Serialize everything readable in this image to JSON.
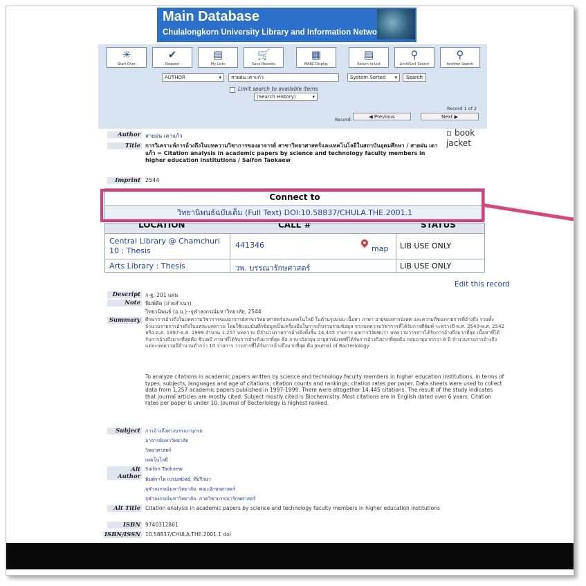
{
  "banner": {
    "title": "Main Database",
    "subtitle": "Chulalongkorn University Library and Information Network"
  },
  "toolbar": {
    "buttons": [
      {
        "label": "Start Over",
        "icon": "✳"
      },
      {
        "label": "Request",
        "icon": "✔"
      },
      {
        "label": "My Lists",
        "icon": "▤"
      },
      {
        "label": "Save Records",
        "icon": "🛒"
      },
      {
        "label": "MARC Display",
        "icon": "▦"
      },
      {
        "label": "Return to List",
        "icon": "▤"
      },
      {
        "label": "Limit/Sort Search",
        "icon": "⚲"
      },
      {
        "label": "Another Search",
        "icon": "⚲"
      }
    ]
  },
  "search": {
    "field_type": "AUTHOR",
    "query": "สายฝน เตาแก้ว",
    "sort": "System Sorted",
    "search_button": "Search",
    "limit_label": "Limit search to available items",
    "history": "(Search History)"
  },
  "record_nav": {
    "record_label": "Record:",
    "record_count": "Record 1 of 2",
    "prev": "Previous",
    "next": "Next"
  },
  "record": {
    "author_label": "Author",
    "author": "สายฝน เตาแก้ว",
    "title_label": "Title",
    "title": "การวิเคราะห์การอ้างถึงในบทความวิชาการของอาจารย์ สาขาวิทยาศาสตร์และเทคโนโลยีในสถาบันอุดมศึกษา / สายฝน เตาแก้ว = Citation analysis in academic papers by science and technology faculty members in higher education institutions / Saifon Taokaew",
    "imprint_label": "Imprint",
    "imprint": "2544",
    "jacket": "book jacket"
  },
  "connect": {
    "heading": "Connect to",
    "link": "วิทยานิพนธ์ฉบับเต็ม (Full Text) DOI:10.58837/CHULA.THE.2001.1"
  },
  "holdings": {
    "headers": [
      "LOCATION",
      "CALL #",
      "STATUS"
    ],
    "rows": [
      {
        "location": "Central Library @ Chamchuri 10 : Thesis",
        "call": "441346",
        "map": "map",
        "status": "LIB USE ONLY"
      },
      {
        "location": "Arts Library : Thesis",
        "call": "วพ. บรรณารักษศาสตร์",
        "map": "",
        "status": "LIB USE ONLY"
      }
    ]
  },
  "edit_link": "Edit this record",
  "details": {
    "descript_label": "Descript",
    "descript": "ก-ฐ, 201 แผ่น",
    "note_label": "Note",
    "note1": "พิมพ์ดีด (ถ่ายสำเนา)",
    "note2": "วิทยานิพนธ์ (อ.ม.)--จุฬาลงกรณ์มหาวิทยาลัย, 2544",
    "summary_label": "Summary",
    "summary_thai": "ศึกษาการอ้างถึงในบทความวิชาการของอาจารย์สาขาวิทยาศาสตร์และเทคโนโลยี ในด้านรูปแบบ เนื้อหา ภาษา อายุของสารนิเทศ และความถี่ของรายการที่อ้างถึง รวมทั้งจำนวนรายการอ้างถึงในแต่ละบทความ โดยใช้แบบบันทึกข้อมูลเป็นเครื่องมือในการเก็บรวบรวมข้อมูล จากบทความวิชาการที่ได้รับการตีพิมพ์ ระหว่างปี พ.ศ. 2540-พ.ศ. 2542 หรือ ค.ศ. 1997-ค.ศ. 1999 จำนวน 1,257 บทความ มีจำนวนรายการอ้างอิงทั้งสิ้น 14,445 รายการ ผลการวิจัยพบว่า บทความวารสารได้รับการอ้างถึงมากที่สุด เนื้อหาที่ได้รับการอ้างถึงมากที่สุดคือ ชีวเคมี ภาษาที่ได้รับการอ้างถึงมากที่สุด คือ ภาษาอังกฤษ อายุสารนิเทศที่ได้รับการอ้างถึงมากที่สุดคือ กลุ่มอายุมากกว่า 6 ปี จำนวนรายการอ้างถึงแต่ละบทความมีจำนวนต่ำกว่า 10 รายการ วารสารที่ได้รับการอ้างถึงมากที่สุด คือ Journal of Bacteriology",
    "summary_en": "To analyze citations in academic papers written by science and technology faculty members in higher education institutions, in terms of types, subjects, languages and age of citations; citation counts and rankings; citation rates per paper. Data sheets were used to collect data from 1,257 academic papers published in 1997-1999. There were altogether 14,445 citations. The result of the study indicates that journal articles are mostly cited. Subject mostly cited is Biochemistry. Most citations are in English dated over 6 years. Citation rates per paper is under 10. Journal of Bacteriology is highest ranked.",
    "subject_label": "Subject",
    "subjects": [
      "การอ้างถึงทางบรรณานุกรม",
      "อาจารย์มหาวิทยาลัย",
      "วิทยาศาสตร์",
      "เทคโนโลยี"
    ],
    "alt_author_label": "Alt Author",
    "alt_authors": [
      "Saifon Taokaew",
      "พิมพ์ราไพ เปรมสมิทธ์, ที่ปรึกษา",
      "จุฬาลงกรณ์มหาวิทยาลัย. คณะอักษรศาสตร์",
      "จุฬาลงกรณ์มหาวิทยาลัย. ภาควิชาบรรณารักษศาสตร์"
    ],
    "alt_title_label": "Alt Title",
    "alt_title": "Citation analysis in academic papers by science and technology faculty members in higher education institutions",
    "isbn_label": "ISBN",
    "isbn": "9740312861",
    "issn_label": "ISBN/ISSN",
    "issn": "10.58837/CHULA.THE.2001.1 doi"
  }
}
